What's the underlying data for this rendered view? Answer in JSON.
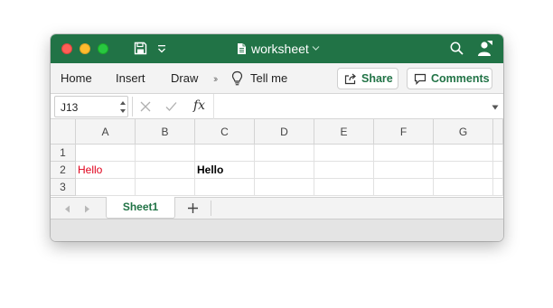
{
  "window": {
    "title": "worksheet",
    "buttons": {
      "close": "close",
      "minimize": "minimize",
      "maximize": "maximize"
    }
  },
  "ribbon": {
    "tabs": [
      "Home",
      "Insert",
      "Draw"
    ],
    "more": "››",
    "tell_me": "Tell me",
    "share_label": "Share",
    "comments_label": "Comments"
  },
  "formula_bar": {
    "name_box": "J13",
    "fx": "fx",
    "formula": ""
  },
  "sheet": {
    "columns": [
      "A",
      "B",
      "C",
      "D",
      "E",
      "F",
      "G"
    ],
    "rows": [
      "1",
      "2",
      "3"
    ],
    "cells": [
      {
        "ref": "A2",
        "value": "Hello",
        "style": "red"
      },
      {
        "ref": "C2",
        "value": "Hello",
        "style": "bold"
      }
    ]
  },
  "sheet_tabs": {
    "active": "Sheet1",
    "add_label": "+"
  },
  "colors": {
    "titlebar": "#217346",
    "accent": "#217346",
    "red_text": "#e0001b"
  },
  "icons": [
    "save-icon",
    "chevron-down-icon",
    "document-icon",
    "search-icon",
    "person-icon",
    "lightbulb-icon",
    "share-icon",
    "comment-icon",
    "close-x-icon",
    "checkmark-icon",
    "arrow-left-icon",
    "arrow-right-icon",
    "plus-icon"
  ]
}
